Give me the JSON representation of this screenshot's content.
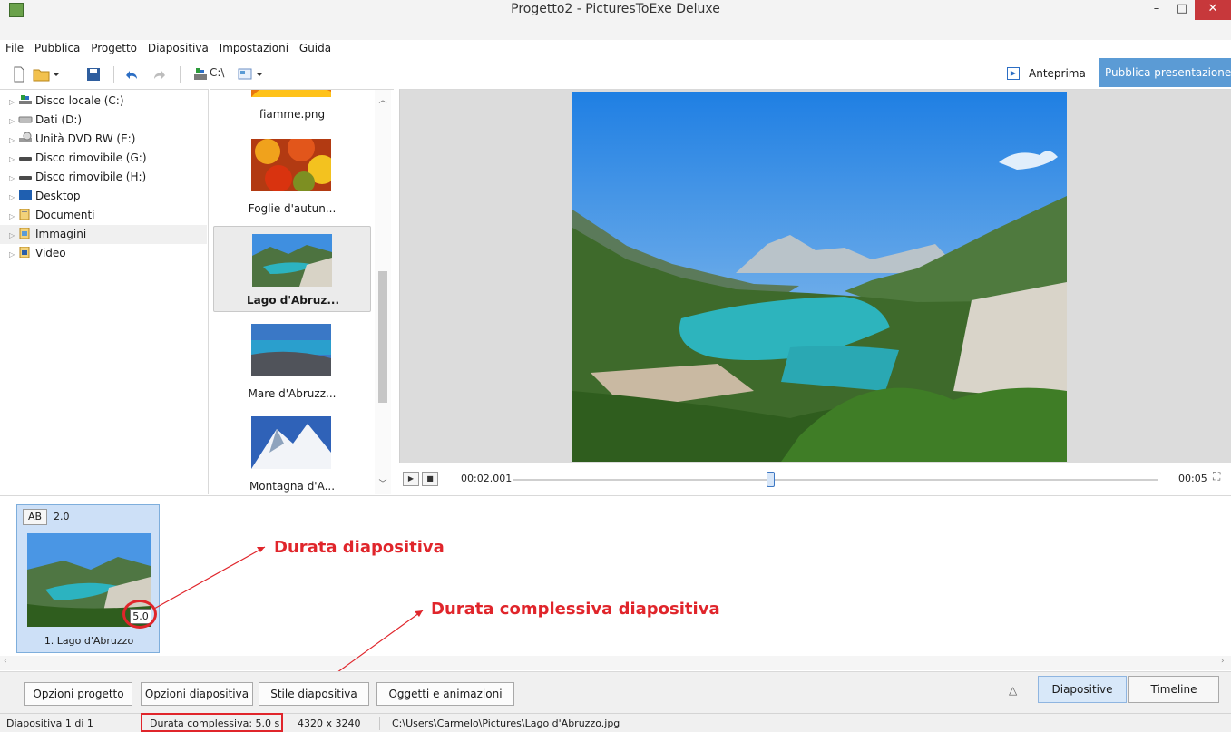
{
  "window": {
    "title": "Progetto2 - PicturesToExe Deluxe",
    "minimize_glyph": "–",
    "maximize_glyph": "□",
    "close_glyph": "✕"
  },
  "menu": [
    "File",
    "Pubblica",
    "Progetto",
    "Diapositiva",
    "Impostazioni",
    "Guida"
  ],
  "toolbar": {
    "drive_label": "C:\\",
    "preview_label": "Anteprima",
    "publish_label": "Pubblica presentazione"
  },
  "tree": [
    {
      "label": "Disco locale (C:)",
      "icon": "drive-icon"
    },
    {
      "label": "Dati (D:)",
      "icon": "hdd-icon"
    },
    {
      "label": "Unità DVD RW (E:)",
      "icon": "dvd-icon"
    },
    {
      "label": "Disco rimovibile (G:)",
      "icon": "removable-drive-icon"
    },
    {
      "label": "Disco rimovibile (H:)",
      "icon": "removable-drive-icon"
    },
    {
      "label": "Desktop",
      "icon": "desktop-icon"
    },
    {
      "label": "Documenti",
      "icon": "documents-folder-icon"
    },
    {
      "label": "Immagini",
      "icon": "pictures-folder-icon",
      "selected": true
    },
    {
      "label": "Video",
      "icon": "video-folder-icon"
    }
  ],
  "thumbnails": [
    {
      "name": "fiamme.png"
    },
    {
      "name": "Foglie d'autun..."
    },
    {
      "name": "Lago d'Abruz...",
      "selected": true
    },
    {
      "name": "Mare d'Abruzz..."
    },
    {
      "name": "Montagna d'A..."
    }
  ],
  "player": {
    "current_time": "00:02.001",
    "total_time": "00:05",
    "progress": 0.4
  },
  "slide": {
    "transition_badge": "AB",
    "transition_duration": "2.0",
    "duration": "5.0",
    "label": "1. Lago d'Abruzzo"
  },
  "annotations": {
    "slide_duration": "Durata diapositiva",
    "total_duration": "Durata complessiva diapositiva"
  },
  "buttons": {
    "project_options": "Opzioni progetto",
    "slide_options": "Opzioni diapositiva",
    "slide_style": "Stile diapositiva",
    "objects_animations": "Oggetti e animazioni",
    "triangle": "△",
    "tab_slides": "Diapositive",
    "tab_timeline": "Timeline"
  },
  "status": {
    "slide_index": "Diapositiva 1 di 1",
    "total_duration": "Durata complessiva: 5.0 s",
    "resolution": "4320 x 3240",
    "path": "C:\\Users\\Carmelo\\Pictures\\Lago d'Abruzzo.jpg"
  },
  "colors": {
    "accent": "#5b9bd5",
    "annotation_red": "#e0252b",
    "selection": "#cde0f7"
  }
}
